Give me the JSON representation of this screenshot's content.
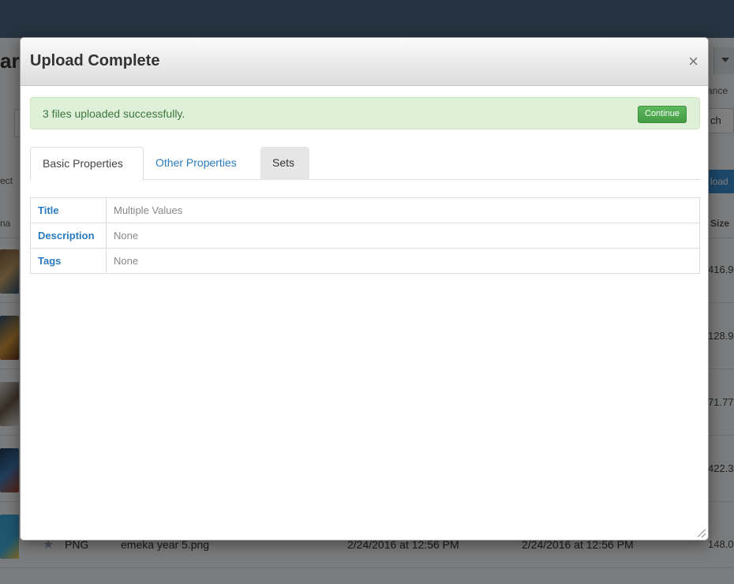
{
  "background": {
    "title_fragment": "ar",
    "advanced_fragment": "ance",
    "search_fragment": "ch",
    "select_fragment": "ect",
    "upload_fragment": "load",
    "name_column_fragment": "na",
    "size_header": "Size",
    "sizes": [
      "416.9",
      "128.9",
      "71.77",
      "422.3",
      "148.0"
    ],
    "last_row": {
      "type": "PNG",
      "filename": "emeka year 5.png",
      "created": "2/24/2016 at 12:56 PM",
      "modified": "2/24/2016 at 12:56 PM"
    }
  },
  "modal": {
    "title": "Upload Complete",
    "close_label": "×",
    "alert": {
      "message": "3 files uploaded successfully.",
      "continue_label": "Continue"
    },
    "tabs": [
      {
        "label": "Basic Properties",
        "active": true
      },
      {
        "label": "Other Properties",
        "active": false
      },
      {
        "label": "Sets",
        "active": false
      }
    ],
    "properties": [
      {
        "key": "Title",
        "value": "Multiple Values"
      },
      {
        "key": "Description",
        "value": "None"
      },
      {
        "key": "Tags",
        "value": "None"
      }
    ]
  },
  "colors": {
    "topbar": "#4a6780",
    "alert_bg": "#dff0d8",
    "alert_text": "#3c763d",
    "continue_button": "#5cb85c",
    "link": "#2a7bbf"
  }
}
